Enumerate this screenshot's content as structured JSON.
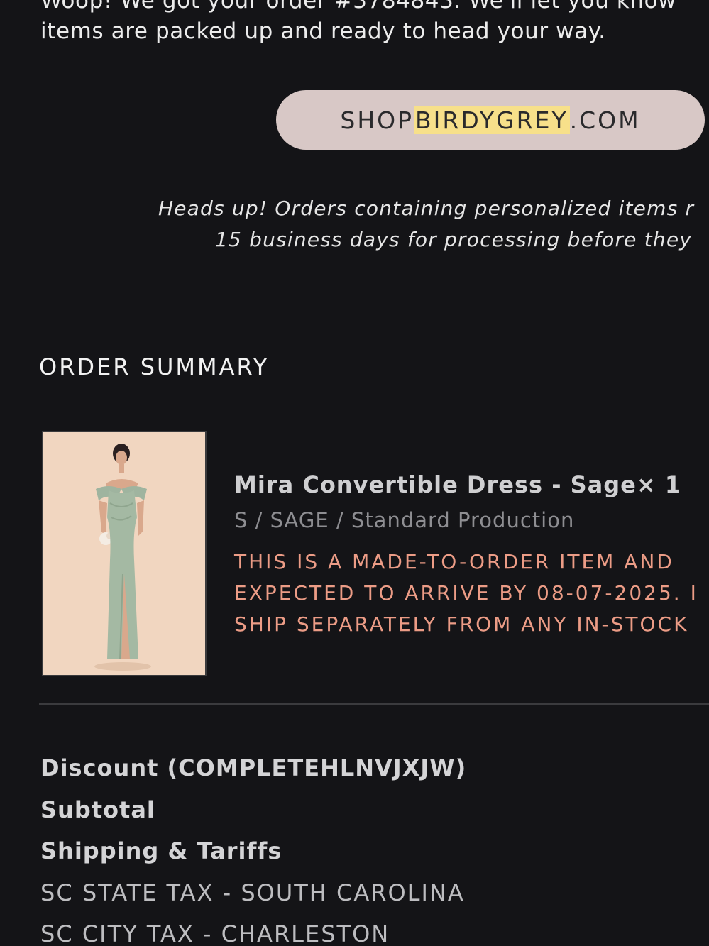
{
  "intro": {
    "line1": "Woop! We got your order #3784843. We'll let you know",
    "line2": "items are packed up and ready to head your way."
  },
  "shop_button": {
    "prefix": "SHOP ",
    "highlight": "BIRDYGREY",
    "suffix": ".COM",
    "bg_color": "#d8c8c6",
    "highlight_color": "#f7e08a"
  },
  "notice": {
    "line1": "Heads up! Orders containing personalized items r",
    "line2": "15 business days for processing before they"
  },
  "order_summary": {
    "title": "ORDER SUMMARY",
    "item": {
      "name": "Mira Convertible Dress - Sage",
      "quantity": "× 1",
      "variant": "S / SAGE / Standard Production",
      "note_lines": [
        "THIS IS A MADE-TO-ORDER ITEM AND",
        "EXPECTED TO ARRIVE BY 08-07-2025. I",
        "SHIP SEPARATELY FROM ANY IN-STOCK"
      ],
      "note_color": "#ec9c86"
    },
    "totals": [
      "Discount (COMPLETEHLNVJXJW)",
      "Subtotal",
      "Shipping & Tariffs",
      "SC STATE TAX - SOUTH CAROLINA",
      "SC CITY TAX - CHARLESTON"
    ]
  }
}
